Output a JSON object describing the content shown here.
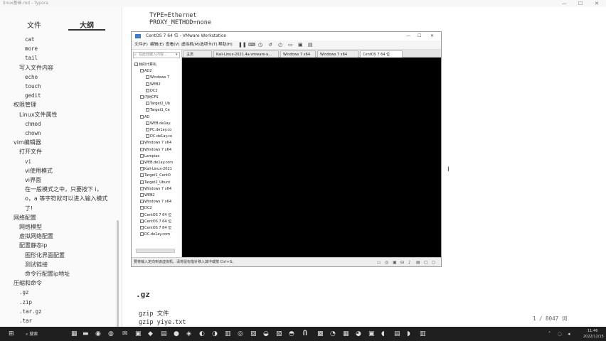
{
  "typora": {
    "title": "linux基础.md - Typora",
    "win_min": "—",
    "win_max": "☐",
    "win_close": "✕"
  },
  "sidebar": {
    "tab_files": "文件",
    "tab_outline": "大纲",
    "items": [
      {
        "text": "cat",
        "level": 2,
        "mono": true
      },
      {
        "text": "more",
        "level": 2,
        "mono": true
      },
      {
        "text": "tail",
        "level": 2,
        "mono": true
      },
      {
        "text": "写入文件内容",
        "level": 1,
        "mono": false
      },
      {
        "text": "echo",
        "level": 2,
        "mono": true
      },
      {
        "text": "touch",
        "level": 2,
        "mono": true
      },
      {
        "text": "gedit",
        "level": 2,
        "mono": true
      },
      {
        "text": "权限管理",
        "level": 0,
        "mono": false
      },
      {
        "text": "Linux文件属性",
        "level": 1,
        "mono": false
      },
      {
        "text": "chmod",
        "level": 2,
        "mono": true
      },
      {
        "text": "chown",
        "level": 2,
        "mono": true
      },
      {
        "text": "vim编辑器",
        "level": 0,
        "mono": false
      },
      {
        "text": "打开文件",
        "level": 1,
        "mono": false
      },
      {
        "text": "vi",
        "level": 2,
        "mono": true
      },
      {
        "text": "vi使用模式",
        "level": 2,
        "mono": false
      },
      {
        "text": "vi界面",
        "level": 2,
        "mono": false
      },
      {
        "text": "在一般模式之中，只要按下 i，",
        "level": 2,
        "mono": false
      },
      {
        "text": "o，a 等字符就可以进入输入模式",
        "level": 2,
        "mono": false
      },
      {
        "text": "了!",
        "level": 2,
        "mono": false
      },
      {
        "text": "网络配置",
        "level": 0,
        "mono": false
      },
      {
        "text": "网络模型",
        "level": 1,
        "mono": false
      },
      {
        "text": "虚拟网络配置",
        "level": 1,
        "mono": false
      },
      {
        "text": "配置静态ip",
        "level": 1,
        "mono": false
      },
      {
        "text": "图形化界面配置",
        "level": 2,
        "mono": false
      },
      {
        "text": "测试链接",
        "level": 2,
        "mono": false
      },
      {
        "text": "命令行配置ip地址",
        "level": 2,
        "mono": false
      },
      {
        "text": "压缩和命令",
        "level": 0,
        "mono": false
      },
      {
        "text": ".gz",
        "level": 1,
        "mono": true
      },
      {
        "text": ".zip",
        "level": 1,
        "mono": true
      },
      {
        "text": ".tar.gz",
        "level": 1,
        "mono": true
      },
      {
        "text": ".tar",
        "level": 1,
        "mono": true
      }
    ]
  },
  "editor": {
    "line1": "TYPE=Ethernet",
    "line2": "PROXY_METHOD=none",
    "heading": ".gz",
    "code1": "gzip 文件",
    "code2": "gzip yiye.txt",
    "word_count": "1 / 8047 词"
  },
  "vmware": {
    "title": "CentOS 7 64 位 - VMware Workstation",
    "menu": [
      "文件(F)",
      "编辑(E)",
      "查看(V)",
      "虚拟机(M)",
      "选项卡(T)",
      "帮助(H)"
    ],
    "toolbar_icons": [
      "pause-icon",
      "send-keys-icon",
      "snapshot-icon",
      "revert-icon",
      "manage-snapshots-icon",
      "fullscreen-icon",
      "unity-icon",
      "view-icon"
    ],
    "library_search": "在此处键入内容…",
    "library_tree": [
      {
        "text": "我的计算机",
        "level": 0
      },
      {
        "text": "AD2",
        "level": 1
      },
      {
        "text": "Windows 7",
        "level": 2
      },
      {
        "text": "WEB2",
        "level": 2
      },
      {
        "text": "DC2",
        "level": 2
      },
      {
        "text": "内网CFS",
        "level": 1
      },
      {
        "text": "Target2_Ub",
        "level": 2
      },
      {
        "text": "Target1_Ce",
        "level": 2
      },
      {
        "text": "AD",
        "level": 1
      },
      {
        "text": "WEB.de1ay.",
        "level": 2
      },
      {
        "text": "PC.de1ay.co",
        "level": 2
      },
      {
        "text": "DC.de1ay.co",
        "level": 2
      },
      {
        "text": "Windows 7 x64",
        "level": 1
      },
      {
        "text": "Windows 7 x64",
        "level": 1
      },
      {
        "text": "Lampiao",
        "level": 1
      },
      {
        "text": "WEB.de1ay.com",
        "level": 1
      },
      {
        "text": "Kali-Linux-2021",
        "level": 1
      },
      {
        "text": "Target1_CentO",
        "level": 1
      },
      {
        "text": "Target2_Ubunt",
        "level": 1
      },
      {
        "text": "Windows 7 x64",
        "level": 1
      },
      {
        "text": "WEB2",
        "level": 1
      },
      {
        "text": "Windows 7 x64",
        "level": 1
      },
      {
        "text": "DC2",
        "level": 1
      },
      {
        "text": "CentOS 7 64 位",
        "level": 1
      },
      {
        "text": "CentOS 7 64 位",
        "level": 1
      },
      {
        "text": "CentOS 7 64 位",
        "level": 1
      },
      {
        "text": "DC.de1ay.com",
        "level": 1
      }
    ],
    "tabs": [
      {
        "label": "主页",
        "active": false
      },
      {
        "label": "Kali-Linux-2021.4a-vmware-a…",
        "active": false
      },
      {
        "label": "Windows 7 x64",
        "active": false
      },
      {
        "label": "Windows 7 x64",
        "active": false
      },
      {
        "label": "CentOS 7 64 位",
        "active": true
      }
    ],
    "status": "要将输入定向到该虚拟机，请将鼠标指针移入其中或按 Ctrl+G。"
  },
  "taskbar": {
    "search": "搜索",
    "time": "11:46",
    "date": "2022/12/15"
  }
}
